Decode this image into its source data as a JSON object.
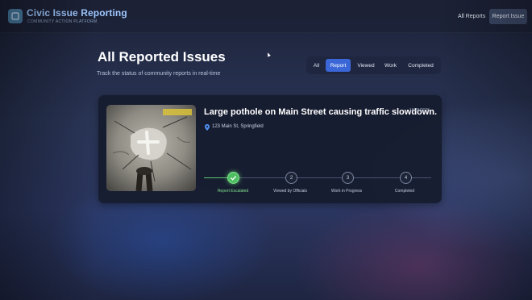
{
  "app": {
    "title": "Civic Issue Reporting",
    "subtitle": "COMMUNITY ACTION PLATFORM"
  },
  "nav": {
    "all_reports": "All Reports",
    "report_issue": "Report Issue"
  },
  "page": {
    "title": "All Reported Issues",
    "subtitle": "Track the status of community reports in real-time"
  },
  "filters": {
    "tabs": [
      {
        "label": "All",
        "active": false
      },
      {
        "label": "Report",
        "active": true
      },
      {
        "label": "Viewed",
        "active": false
      },
      {
        "label": "Work",
        "active": false
      },
      {
        "label": "Completed",
        "active": false
      }
    ]
  },
  "issues": [
    {
      "title": "Large pothole on Main Street causing traffic slowdown.",
      "date": "18/25/2025",
      "location": "123 Main St, Springfield",
      "steps": [
        {
          "number": "",
          "label": "Report Escalated",
          "done": true
        },
        {
          "number": "2",
          "label": "Viewed by Officials",
          "done": false
        },
        {
          "number": "3",
          "label": "Work in Progress",
          "done": false
        },
        {
          "number": "4",
          "label": "Completed",
          "done": false
        }
      ]
    }
  ],
  "colors": {
    "accent": "#3a66d8",
    "success": "#4fbf63",
    "brand": "#9fc8ff"
  }
}
